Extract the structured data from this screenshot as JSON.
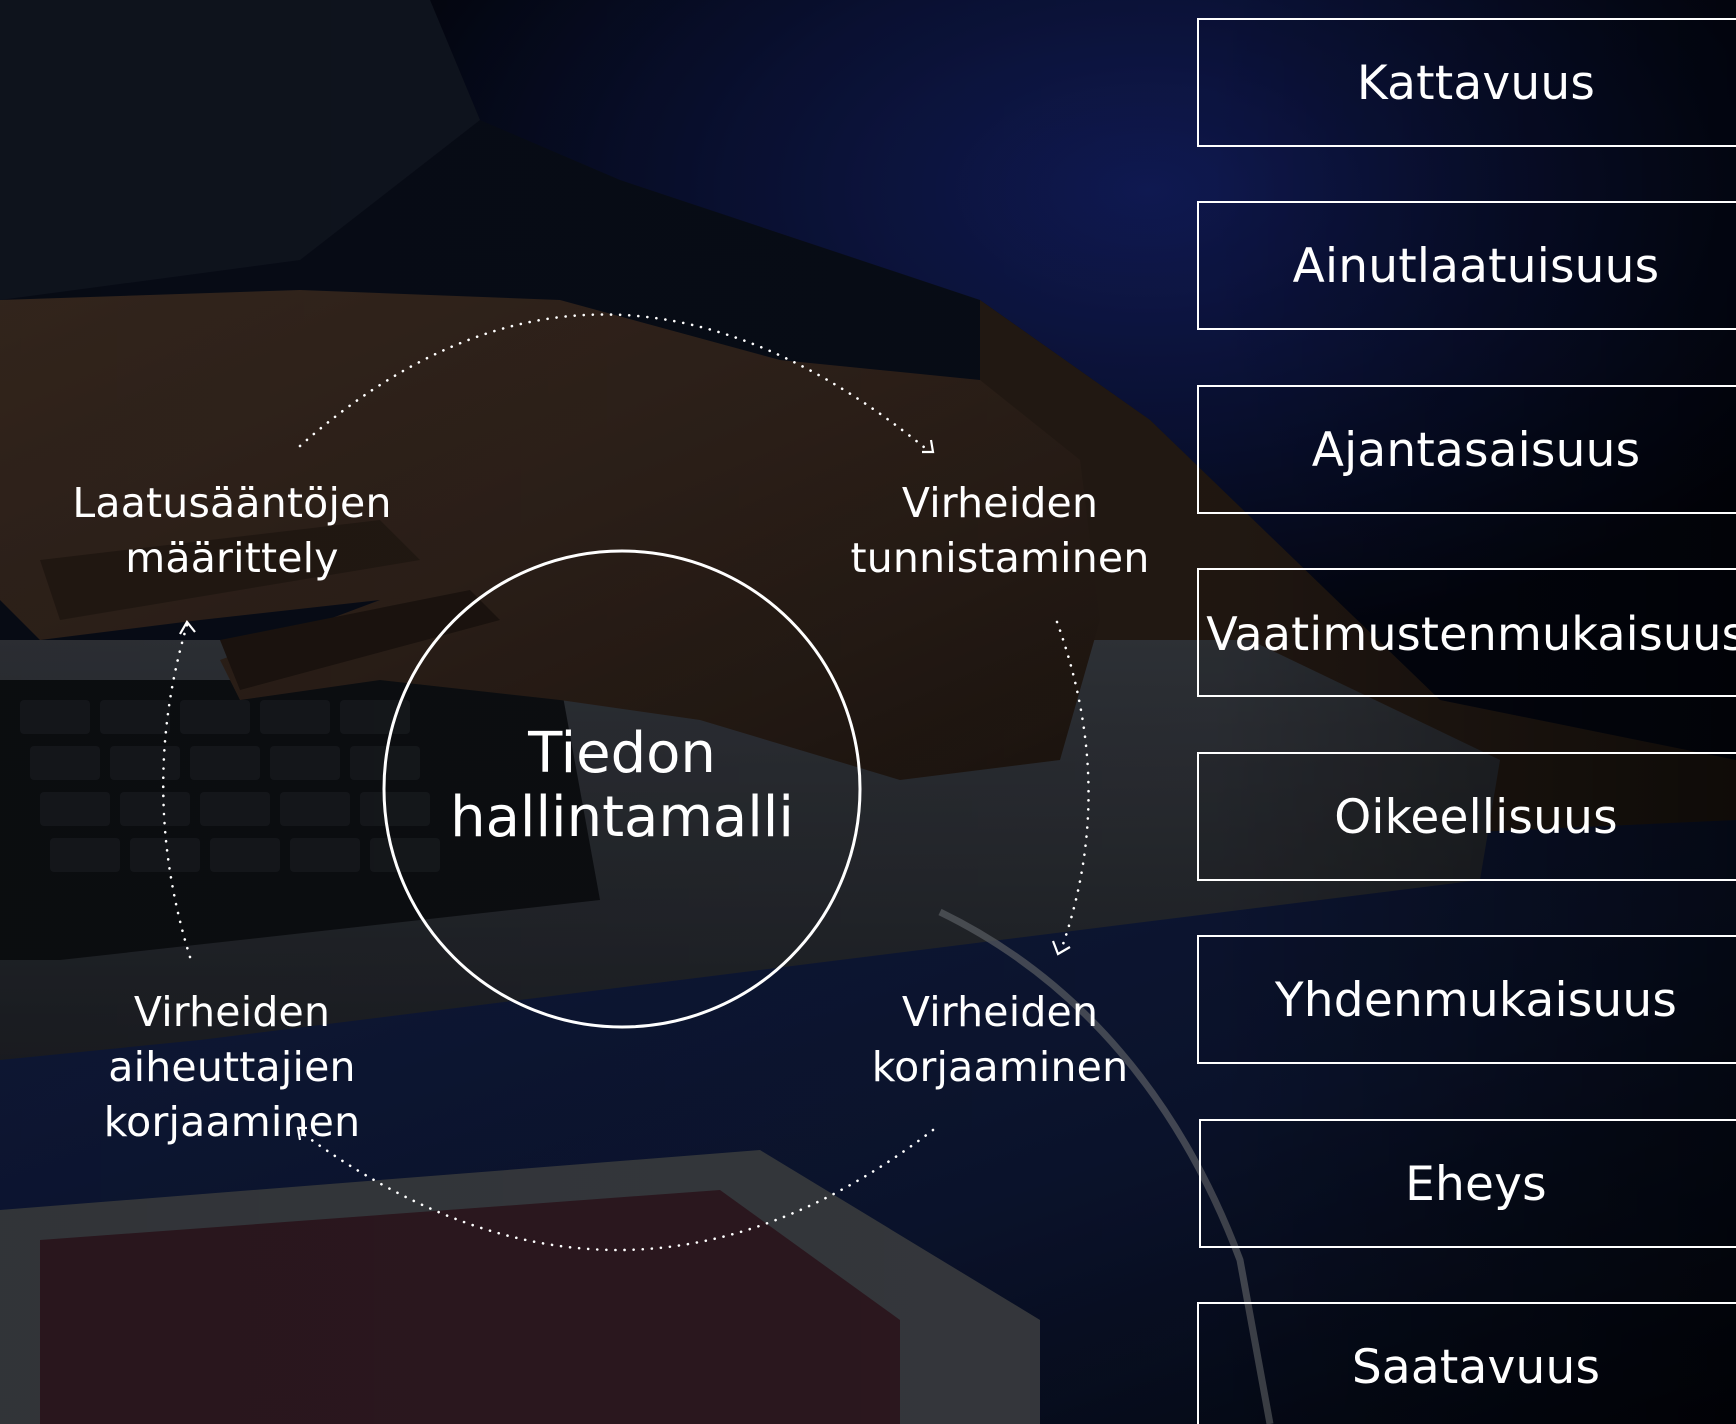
{
  "diagram": {
    "center_title": "Tiedon\nhallintamalli",
    "cycle_steps": [
      {
        "label": "Laatusääntöjen\nmäärittely"
      },
      {
        "label": "Virheiden\ntunnistaminen"
      },
      {
        "label": "Virheiden\nkorjaaminen"
      },
      {
        "label": "Virheiden aiheuttajien\nkorjaaminen"
      }
    ],
    "quality_dimensions": [
      "Kattavuus",
      "Ainutlaatuisuus",
      "Ajantasaisuus",
      "Vaatimustenmukaisuus",
      "Oikeellisuus",
      "Yhdenmukaisuus",
      "Eheys",
      "Saatavuus"
    ]
  },
  "colors": {
    "text": "#ffffff",
    "line": "#ffffff",
    "background_dark": "#0b1220",
    "background_blue": "#1c2d66",
    "skin_tone": "#4a3428"
  }
}
